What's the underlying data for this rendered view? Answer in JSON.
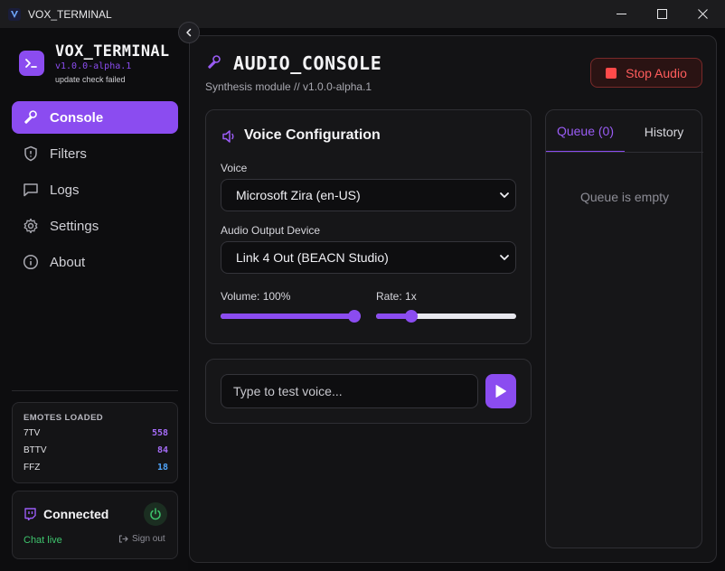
{
  "window": {
    "title": "VOX_TERMINAL"
  },
  "brand": {
    "name": "VOX_TERMINAL",
    "version": "v1.0.0-alpha.1",
    "update_status": "update check failed"
  },
  "nav": [
    {
      "label": "Console",
      "icon": "mic-icon",
      "active": true
    },
    {
      "label": "Filters",
      "icon": "shield-icon",
      "active": false
    },
    {
      "label": "Logs",
      "icon": "message-square-icon",
      "active": false
    },
    {
      "label": "Settings",
      "icon": "gear-icon",
      "active": false
    },
    {
      "label": "About",
      "icon": "info-icon",
      "active": false
    }
  ],
  "emotes": {
    "header": "EMOTES LOADED",
    "rows": [
      {
        "name": "7TV",
        "count": "558",
        "color": "#a56cf7"
      },
      {
        "name": "BTTV",
        "count": "84",
        "color": "#a56cf7"
      },
      {
        "name": "FFZ",
        "count": "18",
        "color": "#4fa3f7"
      }
    ]
  },
  "connection": {
    "status": "Connected",
    "chat_status": "Chat live",
    "sign_out": "Sign out"
  },
  "main": {
    "title": "AUDIO_CONSOLE",
    "subtitle": "Synthesis module // v1.0.0-alpha.1",
    "stop_label": "Stop Audio"
  },
  "voice_config": {
    "title": "Voice Configuration",
    "voice_label": "Voice",
    "voice_value": "Microsoft Zira (en-US)",
    "device_label": "Audio Output Device",
    "device_value": "Link 4 Out (BEACN Studio)",
    "volume_label": "Volume: 100%",
    "volume_value": 1.0,
    "rate_label": "Rate: 1x",
    "rate_value": 0.23
  },
  "test": {
    "placeholder": "Type to test voice..."
  },
  "queue": {
    "tab_queue": "Queue (0)",
    "tab_history": "History",
    "empty_text": "Queue is empty"
  },
  "colors": {
    "accent": "#8b4cf0",
    "danger": "#ff5c5c",
    "live": "#3ec46d"
  }
}
